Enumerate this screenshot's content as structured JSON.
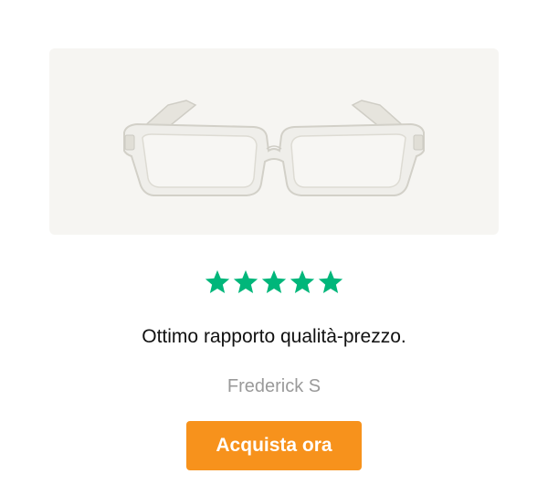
{
  "product": {
    "image_name": "clear-reading-glasses"
  },
  "rating": {
    "value": 5,
    "max": 5,
    "color": "#00b67a"
  },
  "review": {
    "text": "Ottimo rapporto qualità-prezzo.",
    "author": "Frederick S"
  },
  "cta": {
    "label": "Acquista ora",
    "color": "#f7921c"
  }
}
